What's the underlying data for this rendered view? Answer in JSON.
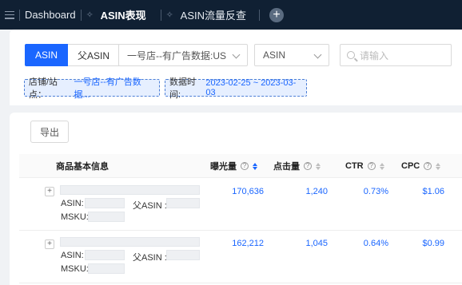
{
  "topbar": {
    "tabs": [
      {
        "label": "Dashboard"
      },
      {
        "label": "ASIN表现"
      },
      {
        "label": "ASIN流量反查"
      }
    ],
    "add_label": "+"
  },
  "filters": {
    "seg_asin": "ASIN",
    "seg_parent": "父ASIN",
    "store_select": "一号店--有广告数据:US",
    "type_select": "ASIN",
    "search_placeholder": "请输入",
    "tag_store_key": "店铺/站点：",
    "tag_store_value": "一号店--有广告数据...",
    "tag_date_key": "数据时间: ",
    "tag_date_value": "2023-02-25 ~ 2023-03-03"
  },
  "table": {
    "export_label": "导出",
    "columns": {
      "product": "商品基本信息",
      "impressions": "曝光量",
      "clicks": "点击量",
      "ctr": "CTR",
      "cpc": "CPC"
    },
    "help_glyph": "?",
    "labels": {
      "asin": "ASIN:",
      "parent_asin": "父ASIN :",
      "msku": "MSKU:"
    },
    "rows": [
      {
        "impressions": "170,636",
        "clicks": "1,240",
        "ctr": "0.73%",
        "cpc": "$1.06",
        "expand": "+"
      },
      {
        "impressions": "162,212",
        "clicks": "1,045",
        "ctr": "0.64%",
        "cpc": "$0.99",
        "expand": "+"
      }
    ]
  }
}
